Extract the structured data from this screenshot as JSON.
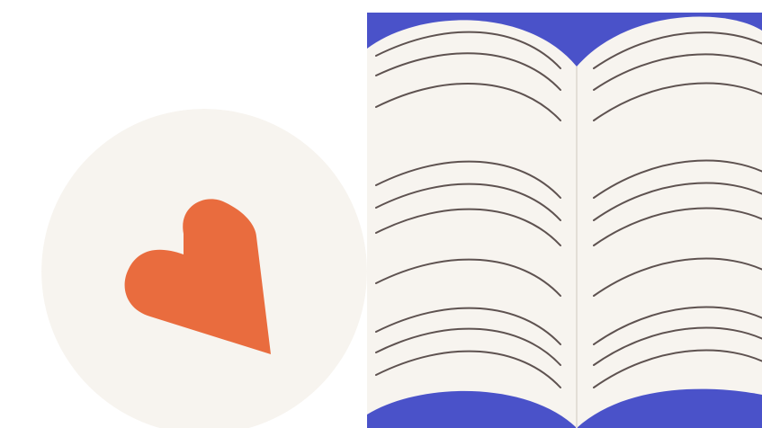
{
  "colors": {
    "page_background": "#ffffff",
    "badge_background": "#f7f4ef",
    "heart": "#e96c3e",
    "book_cover": "#4a52c9",
    "book_paper": "#f7f4ef",
    "book_spine": "#e3ded7",
    "text_line": "#5e5250"
  },
  "icons": {
    "badge_icon": "heart-icon",
    "illustration": "open-book-icon"
  }
}
